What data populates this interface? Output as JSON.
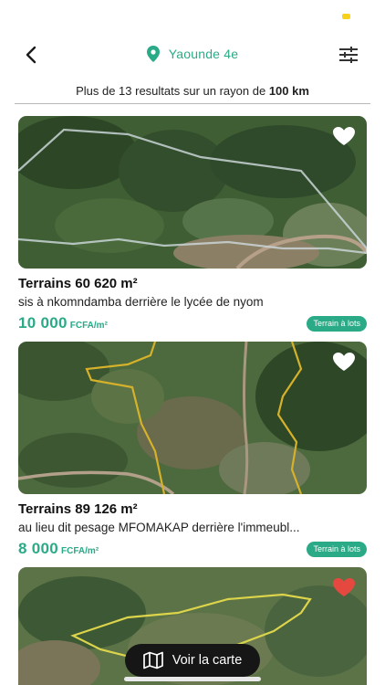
{
  "header": {
    "location": "Yaounde 4e"
  },
  "results": {
    "prefix": "Plus de 13 resultats sur un rayon de",
    "radius": "100 km"
  },
  "listings": [
    {
      "title": "Terrains 60 620 m²",
      "description": "sis à  nkomndamba derrière le lycée de nyom",
      "price": "10 000",
      "unit": "FCFA/m²",
      "badge": "Terrain à lots",
      "favorite": false
    },
    {
      "title": "Terrains 89 126 m²",
      "description": "au lieu dit  pesage MFOMAKAP derrière l'immeubl...",
      "price": "8 000",
      "unit": "FCFA/m²",
      "badge": "Terrain à lots",
      "favorite": false
    },
    {
      "favorite": true
    }
  ],
  "map_button": {
    "label": "Voir la carte"
  },
  "colors": {
    "accent": "#2aaa86",
    "favorite_active": "#e5483e",
    "status_indicator": "#f6d21c"
  },
  "icons": [
    "back-arrow-icon",
    "location-pin-icon",
    "filter-sliders-icon",
    "heart-icon",
    "map-icon"
  ]
}
